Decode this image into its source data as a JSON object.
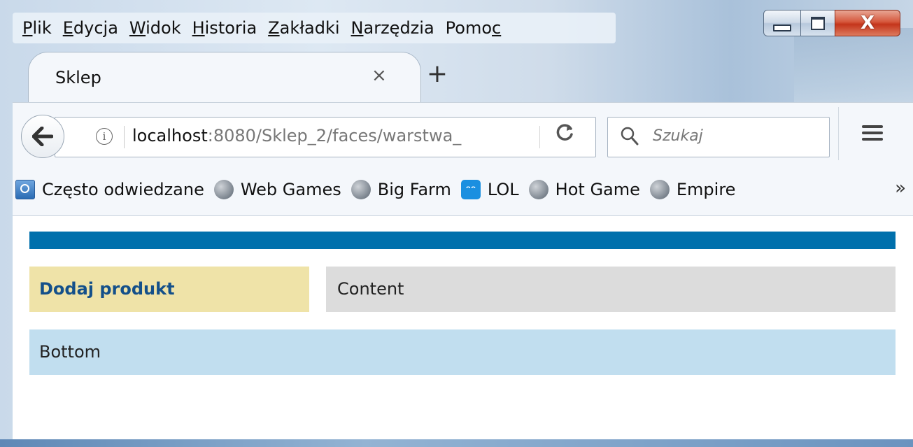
{
  "menubar": {
    "items": [
      {
        "pre": "",
        "key": "P",
        "post": "lik"
      },
      {
        "pre": "",
        "key": "E",
        "post": "dycja"
      },
      {
        "pre": "",
        "key": "W",
        "post": "idok"
      },
      {
        "pre": "",
        "key": "H",
        "post": "istoria"
      },
      {
        "pre": "",
        "key": "Z",
        "post": "akładki"
      },
      {
        "pre": "",
        "key": "N",
        "post": "arzędzia"
      },
      {
        "pre": "Pomo",
        "key": "c",
        "post": ""
      }
    ]
  },
  "window_controls": {
    "close_glyph": "X"
  },
  "tab": {
    "title": "Sklep",
    "close_glyph": "×",
    "new_tab_glyph": "+"
  },
  "navbar": {
    "info_glyph": "i",
    "url_host": "localhost",
    "url_rest": ":8080/Sklep_2/faces/warstwa_",
    "reload_glyph": "C",
    "search_placeholder": "Szukaj"
  },
  "bookmarks": {
    "items": [
      {
        "label": "Często odwiedzane",
        "icon": "bookmark-folder-icon"
      },
      {
        "label": "Web Games",
        "icon": "globe-icon"
      },
      {
        "label": "Big Farm",
        "icon": "globe-icon"
      },
      {
        "label": "LOL",
        "icon": "smiley-icon"
      },
      {
        "label": "Hot Game",
        "icon": "globe-icon"
      },
      {
        "label": "Empire",
        "icon": "globe-icon"
      }
    ],
    "overflow_glyph": "»"
  },
  "page": {
    "left_link": "Dodaj produkt",
    "content_label": "Content",
    "bottom_label": "Bottom",
    "colors": {
      "header": "#0070ac",
      "left": "#efe3a8",
      "content": "#dcdcdc",
      "bottom": "#c1deef",
      "link": "#14508a"
    }
  }
}
